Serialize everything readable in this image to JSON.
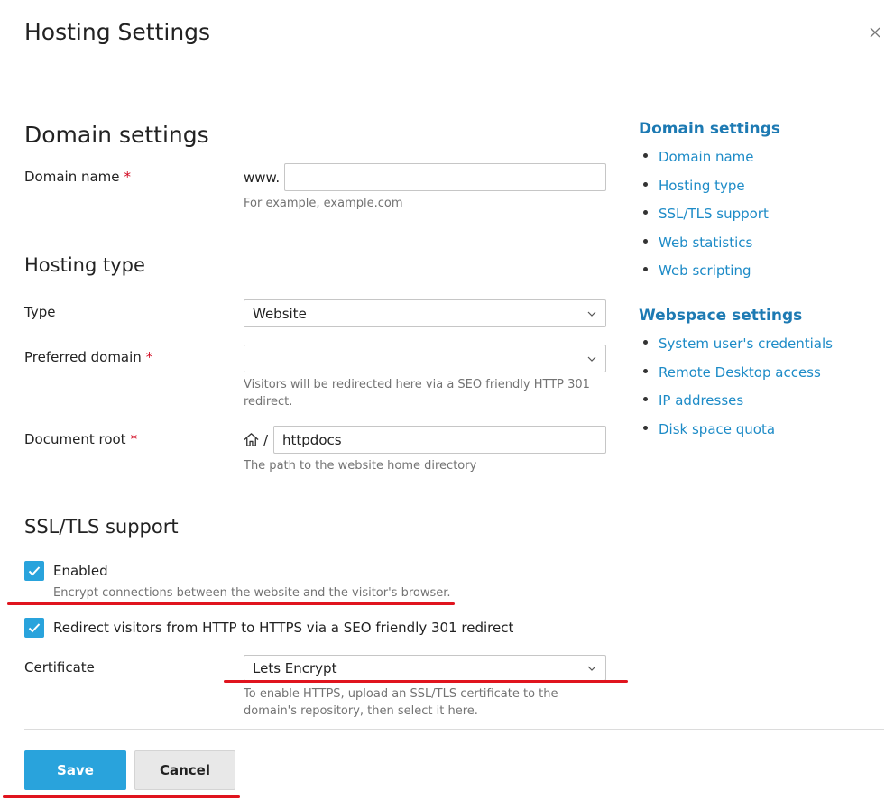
{
  "dialog": {
    "title": "Hosting Settings"
  },
  "domain_settings": {
    "heading": "Domain settings",
    "domain_name_label": "Domain name",
    "required_mark": "*",
    "prefix": "www.",
    "domain_value": "",
    "domain_hint": "For example, example.com"
  },
  "hosting_type": {
    "heading": "Hosting type",
    "type_label": "Type",
    "type_value": "Website",
    "preferred_label": "Preferred domain",
    "preferred_value": "",
    "preferred_hint": "Visitors will be redirected here via a SEO friendly HTTP 301 redirect.",
    "docroot_label": "Document root",
    "docroot_separator": "/",
    "docroot_value": "httpdocs",
    "docroot_hint": "The path to the website home directory"
  },
  "ssl": {
    "heading": "SSL/TLS support",
    "enabled_label": "Enabled",
    "enabled_checked": true,
    "enabled_hint": "Encrypt connections between the website and the visitor's browser.",
    "redirect_label": "Redirect visitors from HTTP to HTTPS via a SEO friendly 301 redirect",
    "redirect_checked": true,
    "certificate_label": "Certificate",
    "certificate_value": "Lets Encrypt",
    "certificate_hint": "To enable HTTPS, upload an SSL/TLS certificate to the domain's repository, then select it here."
  },
  "sidebar": {
    "domain_heading": "Domain settings",
    "domain_items": [
      "Domain name",
      "Hosting type",
      "SSL/TLS support",
      "Web statistics",
      "Web scripting"
    ],
    "webspace_heading": "Webspace settings",
    "webspace_items": [
      "System user's credentials",
      "Remote Desktop access",
      "IP addresses",
      "Disk space quota"
    ]
  },
  "buttons": {
    "save": "Save",
    "cancel": "Cancel"
  },
  "colors": {
    "accent": "#29a3dc",
    "link": "#1d8bc7",
    "annotation": "#e0141e"
  }
}
